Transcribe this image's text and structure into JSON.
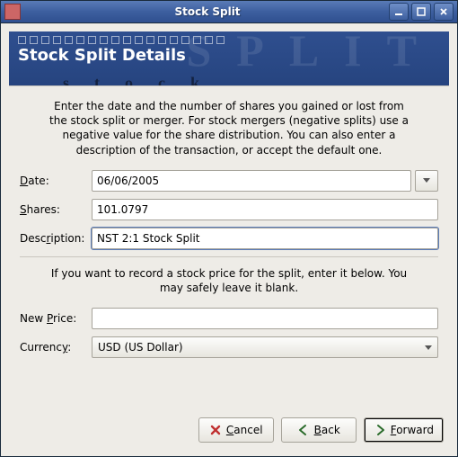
{
  "window": {
    "title": "Stock Split"
  },
  "banner": {
    "title": "Stock Split Details",
    "watermark_big": "SPLIT",
    "watermark_small": "stock"
  },
  "instructions": {
    "top": "Enter the date and the number of shares you gained or lost from the stock split or merger. For stock mergers (negative splits) use a negative value for the share distribution. You can also enter a description of the transaction, or accept the default one.",
    "price": "If you want to record a stock price for the split, enter it below. You may safely leave it blank."
  },
  "labels": {
    "date": "Date:",
    "shares": "Shares:",
    "description": "Description:",
    "new_price": "New Price:",
    "currency": "Currency:"
  },
  "fields": {
    "date": "06/06/2005",
    "shares": "101.0797",
    "description": "NST 2:1 Stock Split",
    "new_price": "",
    "currency": "USD (US Dollar)"
  },
  "buttons": {
    "cancel": "Cancel",
    "back": "Back",
    "forward": "Forward"
  }
}
